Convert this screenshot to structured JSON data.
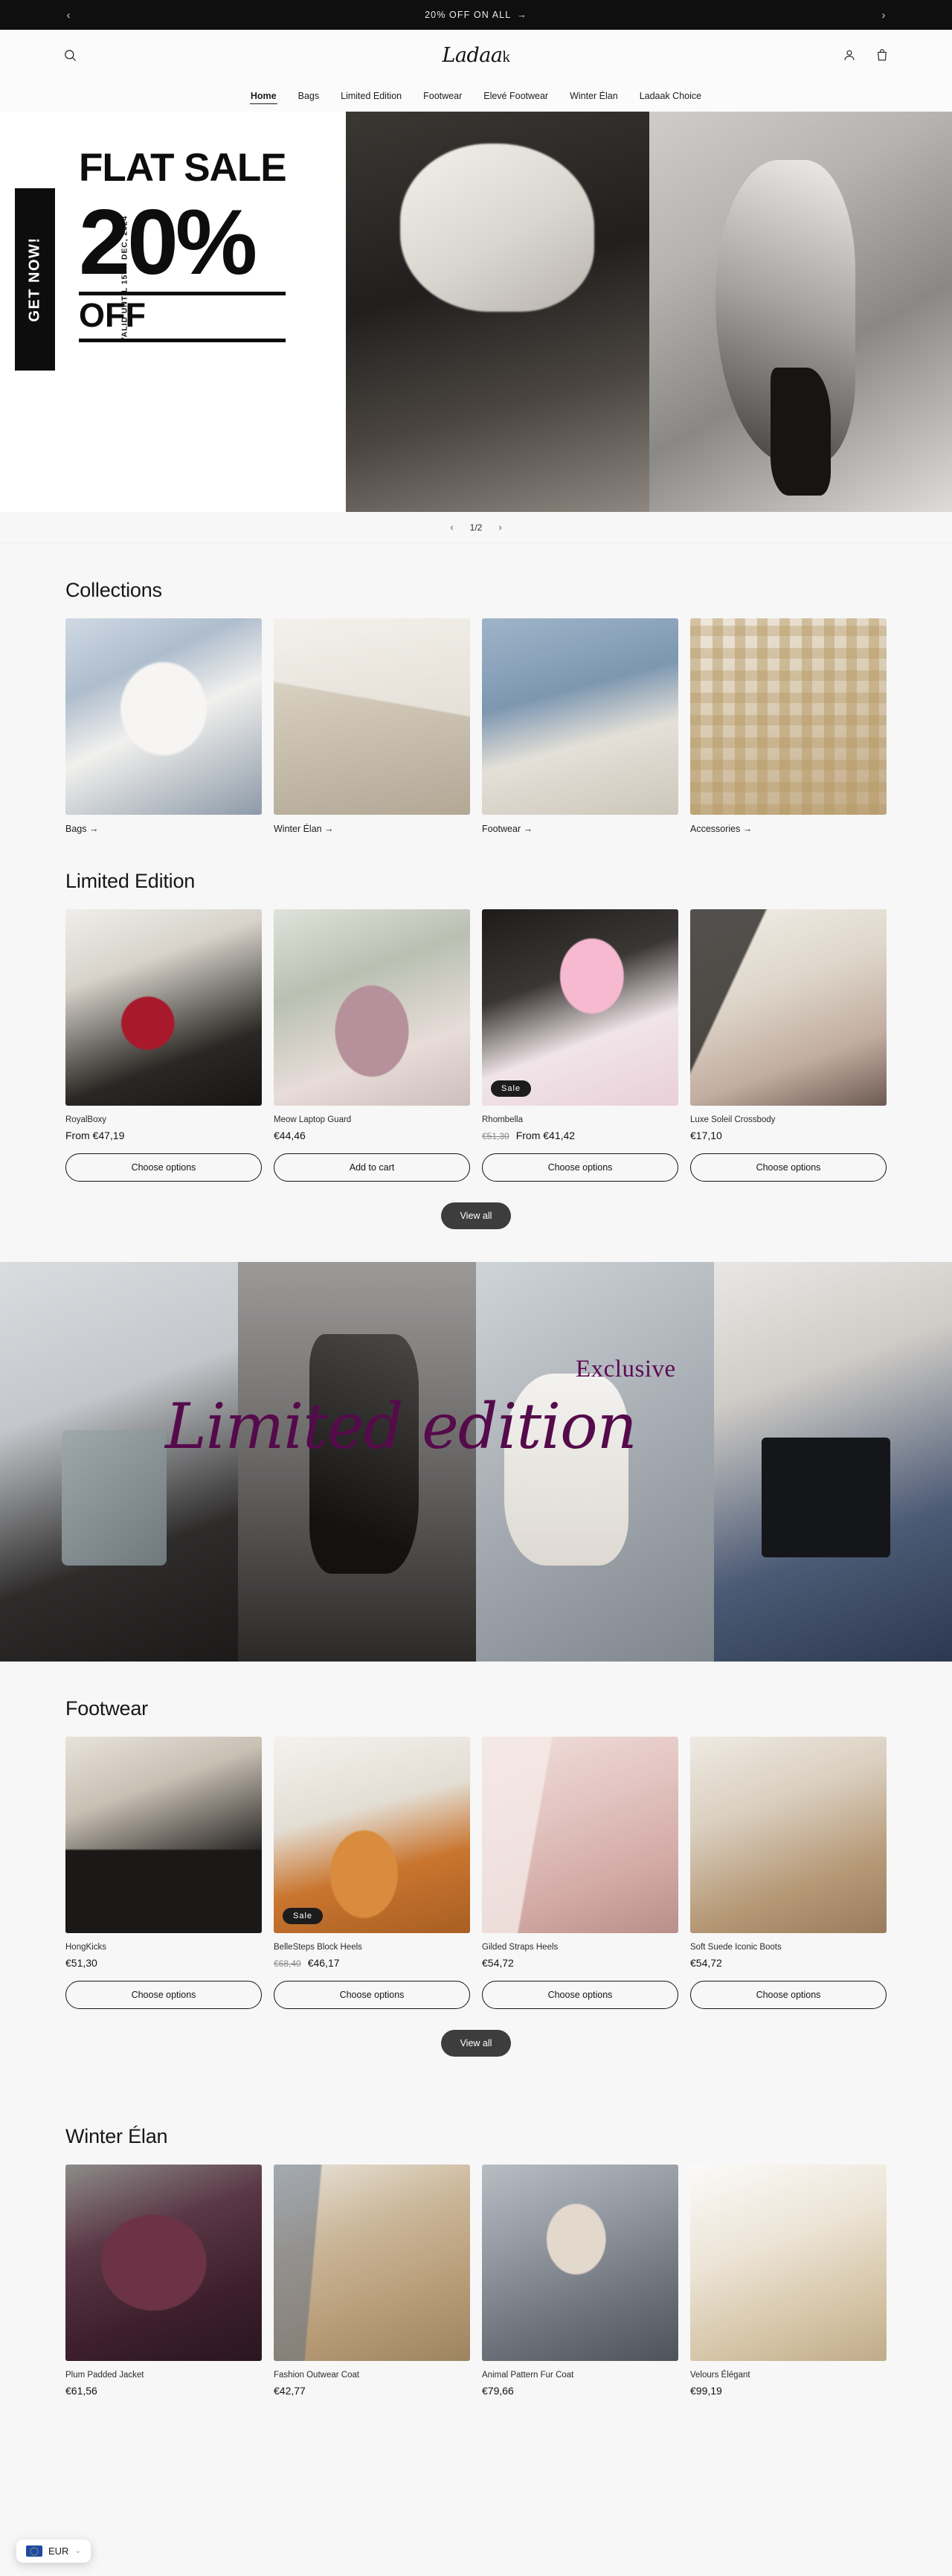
{
  "announcement": {
    "text": "20% OFF ON ALL",
    "arrow": "→",
    "prev_icon": "‹",
    "next_icon": "›"
  },
  "header": {
    "logo": "Ladaa",
    "logo_tail": "k",
    "search_icon": "search-icon",
    "account_icon": "account-icon",
    "cart_icon": "cart-icon"
  },
  "nav": {
    "items": [
      {
        "label": "Home",
        "active": true
      },
      {
        "label": "Bags",
        "active": false
      },
      {
        "label": "Limited Edition",
        "active": false
      },
      {
        "label": "Footwear",
        "active": false
      },
      {
        "label": "Elevé Footwear",
        "active": false
      },
      {
        "label": "Winter Élan",
        "active": false
      },
      {
        "label": "Ladaak Choice",
        "active": false
      }
    ]
  },
  "hero": {
    "badge": "GET NOW!",
    "valid": "VALID UNTIL 15TH DEC, 2024",
    "line1": "FLAT SALE",
    "line2": "20%",
    "line3": "OFF",
    "slide_counter": "1/2",
    "prev": "‹",
    "next": "›"
  },
  "collections": {
    "title": "Collections",
    "items": [
      {
        "label": "Bags →"
      },
      {
        "label": "Winter Élan →"
      },
      {
        "label": "Footwear →"
      },
      {
        "label": "Accessories →"
      }
    ]
  },
  "limited_edition": {
    "title": "Limited Edition",
    "view_all": "View all",
    "products": [
      {
        "name": "RoyalBoxy",
        "price": "From €47,19",
        "old_price": "",
        "badge": "",
        "button": "Choose options"
      },
      {
        "name": "Meow Laptop Guard",
        "price": "€44,46",
        "old_price": "",
        "badge": "",
        "button": "Add to cart"
      },
      {
        "name": "Rhombella",
        "price": "From €41,42",
        "old_price": "€51,30",
        "badge": "Sale",
        "button": "Choose options"
      },
      {
        "name": "Luxe Soleil Crossbody",
        "price": "€17,10",
        "old_price": "",
        "badge": "",
        "button": "Choose options"
      }
    ]
  },
  "exclusive_banner": {
    "eyebrow": "Exclusive",
    "headline": "Limited edition"
  },
  "footwear": {
    "title": "Footwear",
    "view_all": "View all",
    "products": [
      {
        "name": "HongKicks",
        "price": "€51,30",
        "old_price": "",
        "badge": "",
        "button": "Choose options"
      },
      {
        "name": "BelleSteps Block Heels",
        "price": "€46,17",
        "old_price": "€68,40",
        "badge": "Sale",
        "button": "Choose options"
      },
      {
        "name": "Gilded Straps Heels",
        "price": "€54,72",
        "old_price": "",
        "badge": "",
        "button": "Choose options"
      },
      {
        "name": "Soft Suede Iconic Boots",
        "price": "€54,72",
        "old_price": "",
        "badge": "",
        "button": "Choose options"
      }
    ]
  },
  "winter_elan": {
    "title": "Winter Élan",
    "products": [
      {
        "name": "Plum Padded Jacket",
        "price": "€61,56"
      },
      {
        "name": "Fashion Outwear Coat",
        "price": "€42,77"
      },
      {
        "name": "Animal Pattern Fur Coat",
        "price": "€79,66"
      },
      {
        "name": "Velours Élégant",
        "price": "€99,19"
      }
    ]
  },
  "currency": {
    "code": "EUR",
    "chevron": "⌄"
  }
}
